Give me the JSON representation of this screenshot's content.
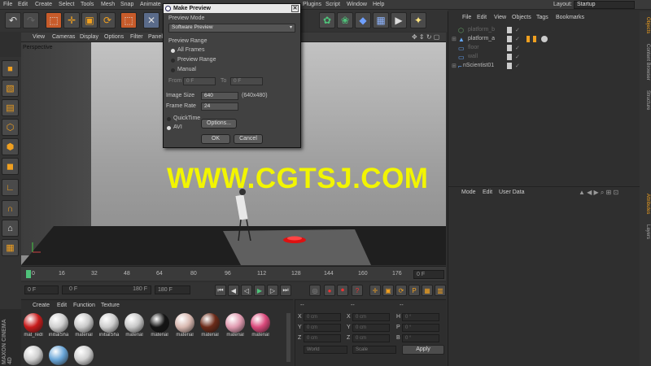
{
  "menubar": {
    "items": [
      "File",
      "Edit",
      "Create",
      "Select",
      "Tools",
      "Mesh",
      "Snap",
      "Animate"
    ],
    "items_right": [
      "Plugins",
      "Script",
      "Window",
      "Help"
    ],
    "layout_label": "Layout:",
    "layout_value": "Startup"
  },
  "viewport": {
    "menu": [
      "View",
      "Cameras",
      "Display",
      "Options",
      "Filter",
      "Panel"
    ],
    "label": "Perspective"
  },
  "timeline": {
    "ticks": [
      "0",
      "16",
      "32",
      "48",
      "64",
      "80",
      "96",
      "112",
      "128",
      "144",
      "160",
      "176"
    ],
    "current_frame": "0 F"
  },
  "transport": {
    "start_field": "0 F",
    "range_start": "0 F",
    "range_end": "180 F",
    "end_field": "180 F"
  },
  "material_manager": {
    "menu": [
      "Create",
      "Edit",
      "Function",
      "Texture"
    ],
    "materials": [
      {
        "label": "mat_redl",
        "color": "#c81c1c"
      },
      {
        "label": "initialSha",
        "color": "#cfcfcf"
      },
      {
        "label": "material",
        "color": "#c9c9c9"
      },
      {
        "label": "initialSha",
        "color": "#cdcdcd"
      },
      {
        "label": "material",
        "color": "#c7c7c7"
      },
      {
        "label": "material",
        "color": "#151515"
      },
      {
        "label": "material",
        "color": "#d8b8b0"
      },
      {
        "label": "material",
        "color": "#6b2a18"
      },
      {
        "label": "material",
        "color": "#e09ab0"
      },
      {
        "label": "material",
        "color": "#d9487a"
      }
    ],
    "row2_colors": [
      "#cfcfcf",
      "#6aa6d8",
      "#d0d0d0"
    ],
    "brand_top": "MAXON",
    "brand_bottom": "CINEMA 4D"
  },
  "coordinates": {
    "header": "--",
    "rows": [
      {
        "a": "X",
        "a_val": "0 cm",
        "b": "X",
        "b_val": "0 cm",
        "c": "H",
        "c_val": "0 °"
      },
      {
        "a": "Y",
        "a_val": "0 cm",
        "b": "Y",
        "b_val": "0 cm",
        "c": "P",
        "c_val": "0 °"
      },
      {
        "a": "Z",
        "a_val": "0 cm",
        "b": "Z",
        "b_val": "0 cm",
        "c": "B",
        "c_val": "0 °"
      }
    ],
    "mode_1": "World",
    "mode_2": "Scale",
    "apply_label": "Apply"
  },
  "object_manager": {
    "menu": [
      "File",
      "Edit",
      "View",
      "Objects",
      "Tags",
      "Bookmarks"
    ],
    "objects": [
      "platform_b",
      "platform_a",
      "floor",
      "wall",
      "nScientist01"
    ]
  },
  "attribute_manager": {
    "menu": [
      "Mode",
      "Edit",
      "User Data"
    ]
  },
  "right_tabs": [
    "Objects",
    "Content Browser",
    "Structure",
    "Attributes",
    "Layers"
  ],
  "dialog": {
    "title": "Make Preview",
    "preview_mode_label": "Preview Mode",
    "preview_mode_value": "Software Preview",
    "preview_range_label": "Preview Range",
    "range_options": [
      "All Frames",
      "Preview Range",
      "Manual"
    ],
    "from_label": "From",
    "from_value": "0 F",
    "to_label": "To",
    "to_value": "0 F",
    "image_size_label": "Image Size",
    "image_size_value": "640",
    "image_size_dims": "(640x480)",
    "frame_rate_label": "Frame Rate",
    "frame_rate_value": "24",
    "format_options": [
      "QuickTime",
      "AVI"
    ],
    "options_button": "Options...",
    "ok_button": "OK",
    "cancel_button": "Cancel"
  },
  "watermark": "WWW.CGTSJ.COM",
  "colors": {
    "accent": "#f2f500",
    "panel": "#2f2f2f"
  }
}
